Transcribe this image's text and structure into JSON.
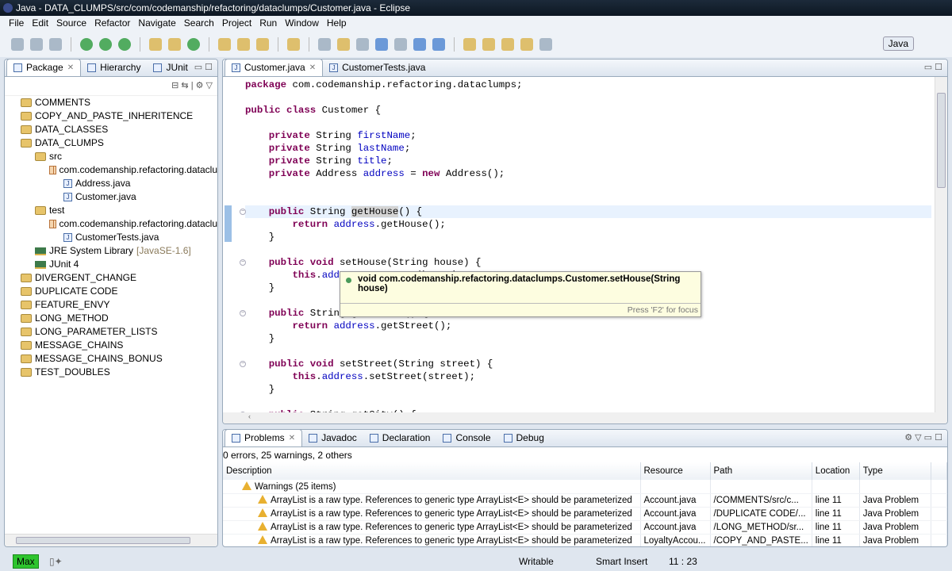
{
  "window": {
    "title": "Java - DATA_CLUMPS/src/com/codemanship/refactoring/dataclumps/Customer.java - Eclipse"
  },
  "menu": [
    "File",
    "Edit",
    "Source",
    "Refactor",
    "Navigate",
    "Search",
    "Project",
    "Run",
    "Window",
    "Help"
  ],
  "perspective": "Java",
  "left_panel": {
    "tabs": [
      {
        "label": "Package",
        "closable": true
      },
      {
        "label": "Hierarchy"
      },
      {
        "label": "JUnit"
      }
    ],
    "tree": [
      {
        "label": "COMMENTS",
        "level": 0,
        "icon": "project"
      },
      {
        "label": "COPY_AND_PASTE_INHERITENCE",
        "level": 0,
        "icon": "project"
      },
      {
        "label": "DATA_CLASSES",
        "level": 0,
        "icon": "project"
      },
      {
        "label": "DATA_CLUMPS",
        "level": 0,
        "icon": "project"
      },
      {
        "label": "src",
        "level": 1,
        "icon": "folder"
      },
      {
        "label": "com.codemanship.refactoring.dataclu",
        "level": 2,
        "icon": "package"
      },
      {
        "label": "Address.java",
        "level": 3,
        "icon": "java"
      },
      {
        "label": "Customer.java",
        "level": 3,
        "icon": "java"
      },
      {
        "label": "test",
        "level": 1,
        "icon": "folder"
      },
      {
        "label": "com.codemanship.refactoring.dataclu",
        "level": 2,
        "icon": "package"
      },
      {
        "label": "CustomerTests.java",
        "level": 3,
        "icon": "java"
      },
      {
        "label": "JRE System Library",
        "suffix": "[JavaSE-1.6]",
        "level": 1,
        "icon": "library"
      },
      {
        "label": "JUnit 4",
        "level": 1,
        "icon": "library"
      },
      {
        "label": "DIVERGENT_CHANGE",
        "level": 0,
        "icon": "project"
      },
      {
        "label": "DUPLICATE CODE",
        "level": 0,
        "icon": "project"
      },
      {
        "label": "FEATURE_ENVY",
        "level": 0,
        "icon": "project"
      },
      {
        "label": "LONG_METHOD",
        "level": 0,
        "icon": "project"
      },
      {
        "label": "LONG_PARAMETER_LISTS",
        "level": 0,
        "icon": "project"
      },
      {
        "label": "MESSAGE_CHAINS",
        "level": 0,
        "icon": "project"
      },
      {
        "label": "MESSAGE_CHAINS_BONUS",
        "level": 0,
        "icon": "project"
      },
      {
        "label": "TEST_DOUBLES",
        "level": 0,
        "icon": "project"
      }
    ]
  },
  "editor": {
    "tabs": [
      {
        "label": "Customer.java",
        "active": true
      },
      {
        "label": "CustomerTests.java"
      }
    ],
    "lines": [
      [
        [
          "kw",
          "package"
        ],
        [
          "t",
          " com.codemanship.refactoring.dataclumps;"
        ]
      ],
      [],
      [
        [
          "kw",
          "public class"
        ],
        [
          "t",
          " Customer {"
        ]
      ],
      [],
      [
        [
          "t",
          "    "
        ],
        [
          "kw",
          "private"
        ],
        [
          "t",
          " String "
        ],
        [
          "fd",
          "firstName"
        ],
        [
          "t",
          ";"
        ]
      ],
      [
        [
          "t",
          "    "
        ],
        [
          "kw",
          "private"
        ],
        [
          "t",
          " String "
        ],
        [
          "fd",
          "lastName"
        ],
        [
          "t",
          ";"
        ]
      ],
      [
        [
          "t",
          "    "
        ],
        [
          "kw",
          "private"
        ],
        [
          "t",
          " String "
        ],
        [
          "fd",
          "title"
        ],
        [
          "t",
          ";"
        ]
      ],
      [
        [
          "t",
          "    "
        ],
        [
          "kw",
          "private"
        ],
        [
          "t",
          " Address "
        ],
        [
          "fd",
          "address"
        ],
        [
          "t",
          " = "
        ],
        [
          "kw",
          "new"
        ],
        [
          "t",
          " Address();"
        ]
      ],
      [],
      [],
      [
        [
          "t",
          "    "
        ],
        [
          "kw",
          "public"
        ],
        [
          "t",
          " String "
        ],
        [
          "sel",
          "getHouse"
        ],
        [
          "t",
          "() {"
        ]
      ],
      [
        [
          "t",
          "        "
        ],
        [
          "kw",
          "return"
        ],
        [
          "t",
          " "
        ],
        [
          "fd",
          "address"
        ],
        [
          "t",
          ".getHouse();"
        ]
      ],
      [
        [
          "t",
          "    }"
        ]
      ],
      [],
      [
        [
          "t",
          "    "
        ],
        [
          "kw",
          "public void"
        ],
        [
          "t",
          " setHouse(String house) {"
        ]
      ],
      [
        [
          "t",
          "        "
        ],
        [
          "kw",
          "this"
        ],
        [
          "t",
          "."
        ],
        [
          "fd",
          "address"
        ],
        [
          "t",
          ".setHouse(house);"
        ]
      ],
      [
        [
          "t",
          "    }"
        ]
      ],
      [],
      [
        [
          "t",
          "    "
        ],
        [
          "kw",
          "public"
        ],
        [
          "t",
          " String getStreet() {"
        ]
      ],
      [
        [
          "t",
          "        "
        ],
        [
          "kw",
          "return"
        ],
        [
          "t",
          " "
        ],
        [
          "fd",
          "address"
        ],
        [
          "t",
          ".getStreet();"
        ]
      ],
      [
        [
          "t",
          "    }"
        ]
      ],
      [],
      [
        [
          "t",
          "    "
        ],
        [
          "kw",
          "public void"
        ],
        [
          "t",
          " setStreet(String street) {"
        ]
      ],
      [
        [
          "t",
          "        "
        ],
        [
          "kw",
          "this"
        ],
        [
          "t",
          "."
        ],
        [
          "fd",
          "address"
        ],
        [
          "t",
          ".setStreet(street);"
        ]
      ],
      [
        [
          "t",
          "    }"
        ]
      ],
      [],
      [
        [
          "t",
          "    "
        ],
        [
          "kw",
          "public"
        ],
        [
          "t",
          " String getCity() {"
        ]
      ]
    ],
    "hover": {
      "signature": "void com.codemanship.refactoring.dataclumps.Customer.setHouse(String house)",
      "footer": "Press 'F2' for focus"
    }
  },
  "bottom_panel": {
    "tabs": [
      {
        "label": "Problems",
        "active": true
      },
      {
        "label": "Javadoc"
      },
      {
        "label": "Declaration"
      },
      {
        "label": "Console"
      },
      {
        "label": "Debug"
      }
    ],
    "summary": "0 errors, 25 warnings, 2 others",
    "columns": [
      "Description",
      "Resource",
      "Path",
      "Location",
      "Type"
    ],
    "group": "Warnings (25 items)",
    "rows": [
      [
        "ArrayList is a raw type. References to generic type ArrayList<E> should be parameterized",
        "Account.java",
        "/COMMENTS/src/c...",
        "line 11",
        "Java Problem"
      ],
      [
        "ArrayList is a raw type. References to generic type ArrayList<E> should be parameterized",
        "Account.java",
        "/DUPLICATE CODE/...",
        "line 11",
        "Java Problem"
      ],
      [
        "ArrayList is a raw type. References to generic type ArrayList<E> should be parameterized",
        "Account.java",
        "/LONG_METHOD/sr...",
        "line 11",
        "Java Problem"
      ],
      [
        "ArrayList is a raw type. References to generic type ArrayList<E> should be parameterized",
        "LoyaltyAccou...",
        "/COPY_AND_PASTE...",
        "line 11",
        "Java Problem"
      ]
    ]
  },
  "status": {
    "max": "Max",
    "writable": "Writable",
    "insert_mode": "Smart Insert",
    "position": "11 : 23"
  }
}
